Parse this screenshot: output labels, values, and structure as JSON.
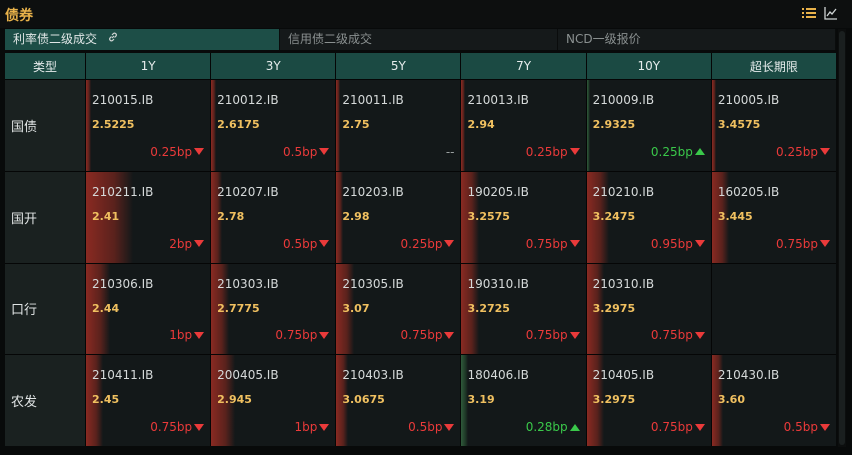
{
  "header": {
    "title": "债券",
    "icons": [
      "list-icon",
      "line-chart-icon"
    ]
  },
  "tabs": [
    {
      "label": "利率债二级成交",
      "active": true,
      "icon": "link-icon"
    },
    {
      "label": "信用债二级成交",
      "active": false
    },
    {
      "label": "NCD一级报价",
      "active": false
    }
  ],
  "table": {
    "type_header": "类型",
    "columns": [
      "1Y",
      "3Y",
      "5Y",
      "7Y",
      "10Y",
      "超长期限"
    ],
    "rows": [
      {
        "label": "国债",
        "cells": [
          {
            "code": "210015.IB",
            "yield": "2.5225",
            "change": "0.25bp",
            "dir": "down",
            "level": 0.04
          },
          {
            "code": "210012.IB",
            "yield": "2.6175",
            "change": "0.5bp",
            "dir": "down",
            "level": 0.04
          },
          {
            "code": "210011.IB",
            "yield": "2.75",
            "change": "--",
            "dir": "flat",
            "level": 0
          },
          {
            "code": "210013.IB",
            "yield": "2.94",
            "change": "0.25bp",
            "dir": "down",
            "level": 0.03
          },
          {
            "code": "210009.IB",
            "yield": "2.9325",
            "change": "0.25bp",
            "dir": "up",
            "level": 0.03
          },
          {
            "code": "210005.IB",
            "yield": "3.4575",
            "change": "0.25bp",
            "dir": "down",
            "level": 0.03
          }
        ]
      },
      {
        "label": "国开",
        "cells": [
          {
            "code": "210211.IB",
            "yield": "2.41",
            "change": "2bp",
            "dir": "down",
            "level": 0.38
          },
          {
            "code": "210207.IB",
            "yield": "2.78",
            "change": "0.5bp",
            "dir": "down",
            "level": 0.09
          },
          {
            "code": "210203.IB",
            "yield": "2.98",
            "change": "0.25bp",
            "dir": "down",
            "level": 0.05
          },
          {
            "code": "190205.IB",
            "yield": "3.2575",
            "change": "0.75bp",
            "dir": "down",
            "level": 0.14
          },
          {
            "code": "210210.IB",
            "yield": "3.2475",
            "change": "0.95bp",
            "dir": "down",
            "level": 0.18
          },
          {
            "code": "160205.IB",
            "yield": "3.445",
            "change": "0.75bp",
            "dir": "down",
            "level": 0.14
          }
        ]
      },
      {
        "label": "口行",
        "cells": [
          {
            "code": "210306.IB",
            "yield": "2.44",
            "change": "1bp",
            "dir": "down",
            "level": 0.19
          },
          {
            "code": "210303.IB",
            "yield": "2.7775",
            "change": "0.75bp",
            "dir": "down",
            "level": 0.14
          },
          {
            "code": "210305.IB",
            "yield": "3.07",
            "change": "0.75bp",
            "dir": "down",
            "level": 0.14
          },
          {
            "code": "190310.IB",
            "yield": "3.2725",
            "change": "0.75bp",
            "dir": "down",
            "level": 0.14
          },
          {
            "code": "210310.IB",
            "yield": "3.2975",
            "change": "0.75bp",
            "dir": "down",
            "level": 0.14
          },
          {
            "code": "",
            "yield": "",
            "change": "",
            "dir": "none",
            "level": 0
          }
        ]
      },
      {
        "label": "农发",
        "cells": [
          {
            "code": "210411.IB",
            "yield": "2.45",
            "change": "0.75bp",
            "dir": "down",
            "level": 0.14
          },
          {
            "code": "200405.IB",
            "yield": "2.945",
            "change": "1bp",
            "dir": "down",
            "level": 0.19
          },
          {
            "code": "210403.IB",
            "yield": "3.0675",
            "change": "0.5bp",
            "dir": "down",
            "level": 0.09
          },
          {
            "code": "180406.IB",
            "yield": "3.19",
            "change": "0.28bp",
            "dir": "up",
            "level": 0.05
          },
          {
            "code": "210405.IB",
            "yield": "3.2975",
            "change": "0.75bp",
            "dir": "down",
            "level": 0.14
          },
          {
            "code": "210430.IB",
            "yield": "3.60",
            "change": "0.5bp",
            "dir": "down",
            "level": 0.09
          }
        ]
      }
    ]
  },
  "colors": {
    "accent": "#e8b24a",
    "header_bg": "#1b4a43",
    "down": "#ea3a3a",
    "up": "#3ac84a"
  }
}
